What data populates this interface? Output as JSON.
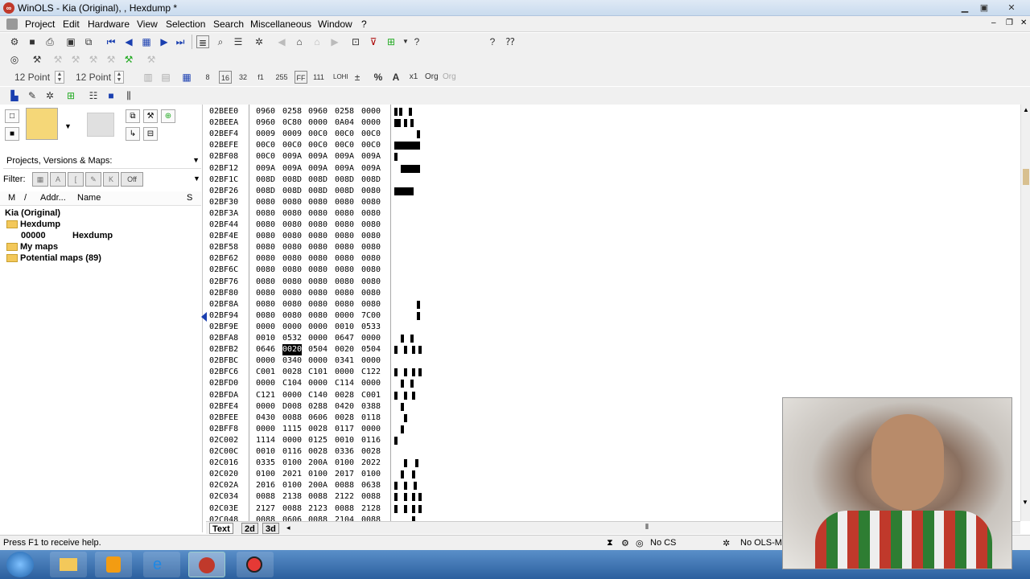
{
  "window": {
    "title": "WinOLS - Kia (Original), , Hexdump *",
    "app_icon": "winols-logo-icon"
  },
  "menubar": [
    "Project",
    "Edit",
    "Hardware",
    "View",
    "Selection",
    "Search",
    "Miscellaneous",
    "Window",
    "?"
  ],
  "toolbar3": {
    "font_size_1": "12 Point",
    "font_size_2": "12 Point"
  },
  "left_panel": {
    "projects_label": "Projects, Versions & Maps:",
    "filter_label": "Filter:",
    "filter_off": "Off",
    "columns": {
      "m": "M",
      "slash": "/",
      "addr": "Addr...",
      "name": "Name",
      "s": "S"
    },
    "tree": [
      {
        "text": "Kia (Original)",
        "level": 0,
        "folder": false
      },
      {
        "text": "Hexdump",
        "level": 0,
        "folder": true
      },
      {
        "addr": "00000",
        "name": "Hexdump",
        "level": 1
      },
      {
        "text": "My maps",
        "level": 0,
        "folder": true
      },
      {
        "text": "Potential maps (89)",
        "level": 0,
        "folder": true
      }
    ]
  },
  "hex": {
    "rows": [
      {
        "addr": "02BEE0",
        "vals": [
          "0960",
          "0258",
          "0960",
          "0258",
          "0000"
        ]
      },
      {
        "addr": "02BEEA",
        "vals": [
          "0960",
          "0C80",
          "0000",
          "0A04",
          "0000"
        ]
      },
      {
        "addr": "02BEF4",
        "vals": [
          "0009",
          "0009",
          "00C0",
          "00C0",
          "00C0"
        ]
      },
      {
        "addr": "02BEFE",
        "vals": [
          "00C0",
          "00C0",
          "00C0",
          "00C0",
          "00C0"
        ]
      },
      {
        "addr": "02BF08",
        "vals": [
          "00C0",
          "009A",
          "009A",
          "009A",
          "009A"
        ]
      },
      {
        "addr": "02BF12",
        "vals": [
          "009A",
          "009A",
          "009A",
          "009A",
          "009A"
        ]
      },
      {
        "addr": "02BF1C",
        "vals": [
          "008D",
          "008D",
          "008D",
          "008D",
          "008D"
        ]
      },
      {
        "addr": "02BF26",
        "vals": [
          "008D",
          "008D",
          "008D",
          "008D",
          "0080"
        ]
      },
      {
        "addr": "02BF30",
        "vals": [
          "0080",
          "0080",
          "0080",
          "0080",
          "0080"
        ]
      },
      {
        "addr": "02BF3A",
        "vals": [
          "0080",
          "0080",
          "0080",
          "0080",
          "0080"
        ]
      },
      {
        "addr": "02BF44",
        "vals": [
          "0080",
          "0080",
          "0080",
          "0080",
          "0080"
        ]
      },
      {
        "addr": "02BF4E",
        "vals": [
          "0080",
          "0080",
          "0080",
          "0080",
          "0080"
        ]
      },
      {
        "addr": "02BF58",
        "vals": [
          "0080",
          "0080",
          "0080",
          "0080",
          "0080"
        ]
      },
      {
        "addr": "02BF62",
        "vals": [
          "0080",
          "0080",
          "0080",
          "0080",
          "0080"
        ]
      },
      {
        "addr": "02BF6C",
        "vals": [
          "0080",
          "0080",
          "0080",
          "0080",
          "0080"
        ]
      },
      {
        "addr": "02BF76",
        "vals": [
          "0080",
          "0080",
          "0080",
          "0080",
          "0080"
        ]
      },
      {
        "addr": "02BF80",
        "vals": [
          "0080",
          "0080",
          "0080",
          "0080",
          "0080"
        ]
      },
      {
        "addr": "02BF8A",
        "vals": [
          "0080",
          "0080",
          "0080",
          "0080",
          "0080"
        ]
      },
      {
        "addr": "02BF94",
        "vals": [
          "0080",
          "0080",
          "0080",
          "0000",
          "7C00"
        ]
      },
      {
        "addr": "02BF9E",
        "vals": [
          "0000",
          "0000",
          "0000",
          "0010",
          "0533"
        ]
      },
      {
        "addr": "02BFA8",
        "vals": [
          "0010",
          "0532",
          "0000",
          "0647",
          "0000"
        ]
      },
      {
        "addr": "02BFB2",
        "vals": [
          "0646",
          "0020",
          "0504",
          "0020",
          "0504"
        ]
      },
      {
        "addr": "02BFBC",
        "vals": [
          "0000",
          "0340",
          "0000",
          "0341",
          "0000"
        ]
      },
      {
        "addr": "02BFC6",
        "vals": [
          "C001",
          "0028",
          "C101",
          "0000",
          "C122"
        ]
      },
      {
        "addr": "02BFD0",
        "vals": [
          "0000",
          "C104",
          "0000",
          "C114",
          "0000"
        ]
      },
      {
        "addr": "02BFDA",
        "vals": [
          "C121",
          "0000",
          "C140",
          "0028",
          "C001"
        ]
      },
      {
        "addr": "02BFE4",
        "vals": [
          "0000",
          "D008",
          "0288",
          "0420",
          "0388"
        ]
      },
      {
        "addr": "02BFEE",
        "vals": [
          "0430",
          "0088",
          "0606",
          "0028",
          "0118"
        ]
      },
      {
        "addr": "02BFF8",
        "vals": [
          "0000",
          "1115",
          "0028",
          "0117",
          "0000"
        ]
      },
      {
        "addr": "02C002",
        "vals": [
          "1114",
          "0000",
          "0125",
          "0010",
          "0116"
        ]
      },
      {
        "addr": "02C00C",
        "vals": [
          "0010",
          "0116",
          "0028",
          "0336",
          "0028"
        ]
      },
      {
        "addr": "02C016",
        "vals": [
          "0335",
          "0100",
          "200A",
          "0100",
          "2022"
        ]
      },
      {
        "addr": "02C020",
        "vals": [
          "0100",
          "2021",
          "0100",
          "2017",
          "0100"
        ]
      },
      {
        "addr": "02C02A",
        "vals": [
          "2016",
          "0100",
          "200A",
          "0088",
          "0638"
        ]
      },
      {
        "addr": "02C034",
        "vals": [
          "0088",
          "2138",
          "0088",
          "2122",
          "0088"
        ]
      },
      {
        "addr": "02C03E",
        "vals": [
          "2127",
          "0088",
          "2123",
          "0088",
          "2128"
        ]
      },
      {
        "addr": "02C048",
        "vals": [
          "0088",
          "0606",
          "0088",
          "2104",
          "0088"
        ]
      }
    ],
    "highlight": {
      "row": 21,
      "col": 1
    }
  },
  "bottom_tabs": [
    "Text",
    "2d",
    "3d"
  ],
  "status": {
    "help": "Press F1 to receive help.",
    "cs": "No CS",
    "ols": "No OLS-M"
  },
  "colors": {
    "title_bg": "#c9dbee",
    "taskbar": "#2b5f9e",
    "highlight": "#000000"
  }
}
